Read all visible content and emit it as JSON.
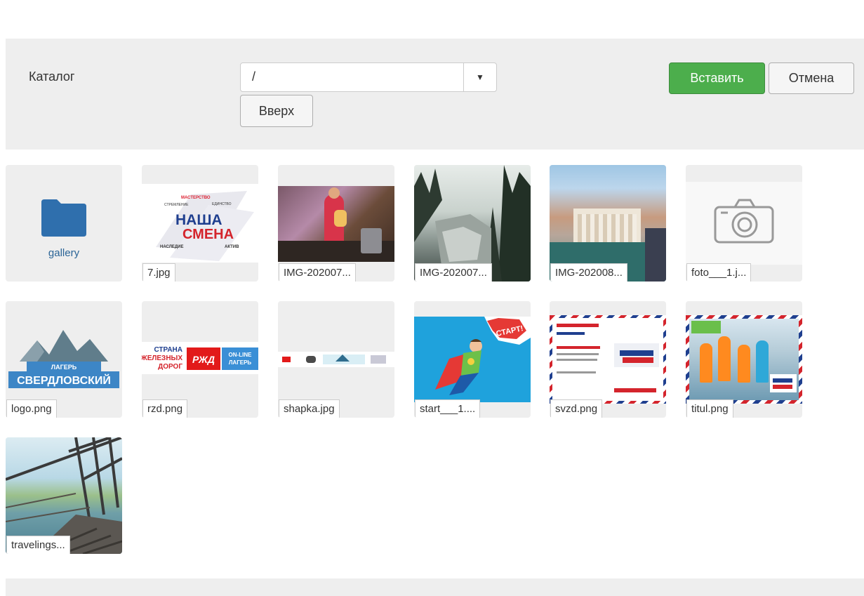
{
  "toolbar": {
    "catalog_label": "Каталог",
    "folder_select_value": "/",
    "up_button": "Вверх",
    "insert_button": "Вставить",
    "cancel_button": "Отмена"
  },
  "items": [
    {
      "name": "gallery",
      "type": "folder"
    },
    {
      "name": "7.jpg",
      "type": "image"
    },
    {
      "name": "IMG-202007...",
      "type": "image"
    },
    {
      "name": "IMG-202007...",
      "type": "image"
    },
    {
      "name": "IMG-202008...",
      "type": "image"
    },
    {
      "name": "foto___1.j...",
      "type": "image"
    },
    {
      "name": "logo.png",
      "type": "image"
    },
    {
      "name": "rzd.png",
      "type": "image"
    },
    {
      "name": "shapka.jpg",
      "type": "image"
    },
    {
      "name": "start___1....",
      "type": "image"
    },
    {
      "name": "svzd.png",
      "type": "image"
    },
    {
      "name": "titul.png",
      "type": "image"
    },
    {
      "name": "travelings...",
      "type": "image"
    }
  ],
  "thumb_text": {
    "nasha": "НАША",
    "smena": "СМЕНА",
    "masterstvo": "МАСТЕРСТВО",
    "stremlenie": "СТРЕМЛЕНИЕ",
    "edinstvo": "ЕДИНСТВО",
    "nasledie": "НАСЛЕДИЕ",
    "aktiv": "АКТИВ",
    "lager": "ЛАГЕРЬ",
    "sverdlovsky": "СВЕРДЛОВСКИЙ",
    "strana": "СТРАНА",
    "zheleznyh": "ЖЕЛЕЗНЫХ",
    "dorog": "ДОРОГ",
    "rzd": "РЖД",
    "online": "ON-LINE",
    "lager2": "ЛАГЕРЬ",
    "start": "СТАРТ!"
  },
  "colors": {
    "accent_green": "#4cae4c",
    "folder_blue": "#2f6fad",
    "panel_gray": "#eeeeee"
  }
}
